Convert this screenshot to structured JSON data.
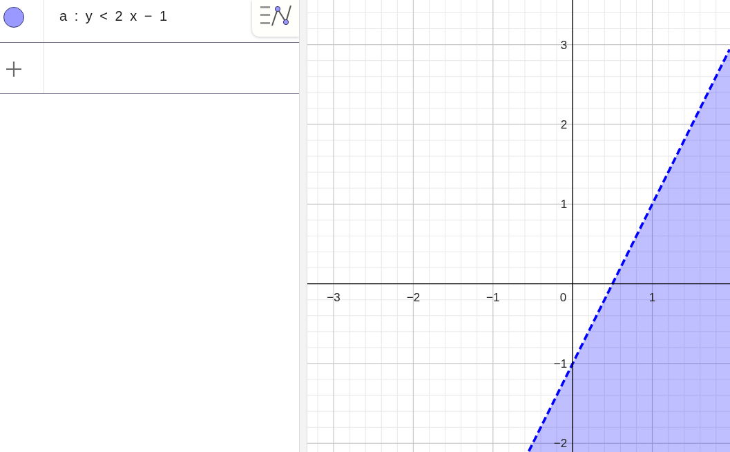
{
  "algebra": {
    "items": [
      {
        "expression": "a : y < 2 x − 1",
        "color": "#9999ff",
        "shown": true
      }
    ]
  },
  "graphics": {
    "origin_label": "0",
    "shaded_below": true,
    "chart_data": {
      "type": "line",
      "grid": true,
      "xlim": [
        -3.33,
        1.975
      ],
      "ylim": [
        -2.11,
        3.56
      ],
      "x": [
        -0.55,
        0,
        0.5,
        1,
        1.5,
        1.97
      ],
      "series": [
        {
          "color": "#0000ff",
          "line_style": "dashed",
          "values": [
            -2.1,
            -1,
            0,
            1,
            2,
            2.94
          ]
        }
      ],
      "xticks": [
        {
          "value": -3,
          "label": "−3"
        },
        {
          "value": -2,
          "label": "−2"
        },
        {
          "value": -1,
          "label": "−1"
        },
        {
          "value": 1,
          "label": "1"
        }
      ],
      "yticks": [
        {
          "value": -2,
          "label": "−2"
        },
        {
          "value": -1,
          "label": "−1"
        },
        {
          "value": 1,
          "label": "1"
        },
        {
          "value": 2,
          "label": "2"
        },
        {
          "value": 3,
          "label": "3"
        }
      ]
    }
  }
}
